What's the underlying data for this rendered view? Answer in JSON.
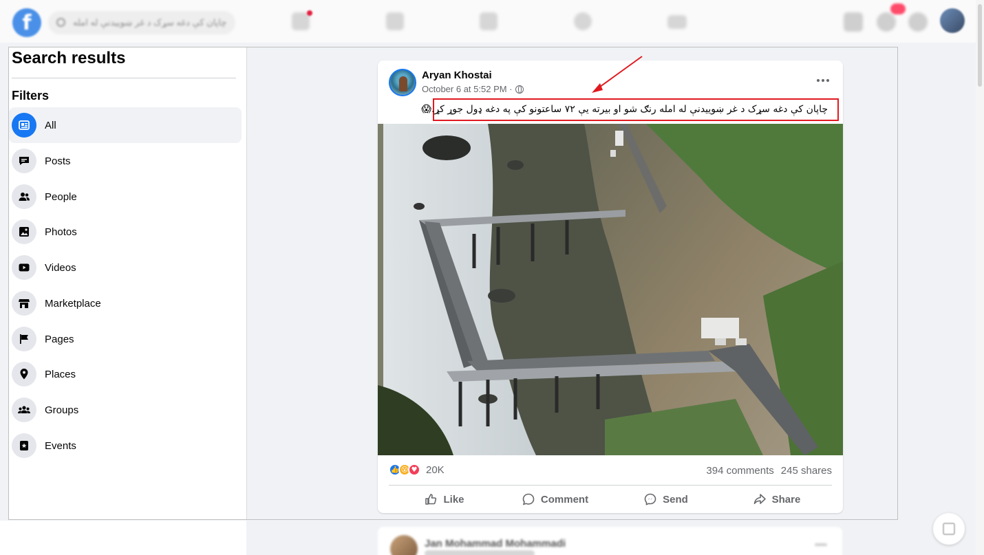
{
  "topnav": {
    "logo": "f",
    "search_placeholder": "چاپان کې دغه سړک د غر ښوییدنې له امله",
    "notification_icons": [
      "home-icon",
      "video-icon",
      "marketplace-icon",
      "groups-icon",
      "gaming-icon"
    ],
    "right_icons": [
      "menu-icon",
      "messenger-icon",
      "notifications-icon"
    ]
  },
  "sidebar": {
    "title": "Search results",
    "filters_heading": "Filters",
    "items": [
      {
        "label": "All",
        "icon": "feed-icon",
        "active": true
      },
      {
        "label": "Posts",
        "icon": "posts-icon",
        "active": false
      },
      {
        "label": "People",
        "icon": "people-icon",
        "active": false
      },
      {
        "label": "Photos",
        "icon": "photos-icon",
        "active": false
      },
      {
        "label": "Videos",
        "icon": "videos-icon",
        "active": false
      },
      {
        "label": "Marketplace",
        "icon": "marketplace-icon",
        "active": false
      },
      {
        "label": "Pages",
        "icon": "pages-icon",
        "active": false
      },
      {
        "label": "Places",
        "icon": "places-icon",
        "active": false
      },
      {
        "label": "Groups",
        "icon": "groups-icon",
        "active": false
      },
      {
        "label": "Events",
        "icon": "events-icon",
        "active": false
      }
    ]
  },
  "post": {
    "author": "Aryan Khostai",
    "timestamp": "October 6 at 5:52 PM ·",
    "privacy_icon": "globe-icon",
    "caption": "چاپان کې دغه سړک د غر ښوییدنې له امله رنګ شو او بیرته یې ۷۲ ساعتونو کې په دغه ډول جوړ کړ.😱",
    "reactions": {
      "icons": [
        "like-icon",
        "wow-icon",
        "love-icon"
      ],
      "count": "20K"
    },
    "comments": "394 comments",
    "shares": "245 shares",
    "actions": {
      "like": "Like",
      "comment": "Comment",
      "send": "Send",
      "share": "Share"
    }
  },
  "next_post": {
    "author": "Jan Mohammad Mohammadi"
  },
  "colors": {
    "brand_blue": "#1877f2",
    "annotation_red": "#e0191f",
    "page_bg": "#f0f2f5",
    "muted_text": "#65676b"
  }
}
